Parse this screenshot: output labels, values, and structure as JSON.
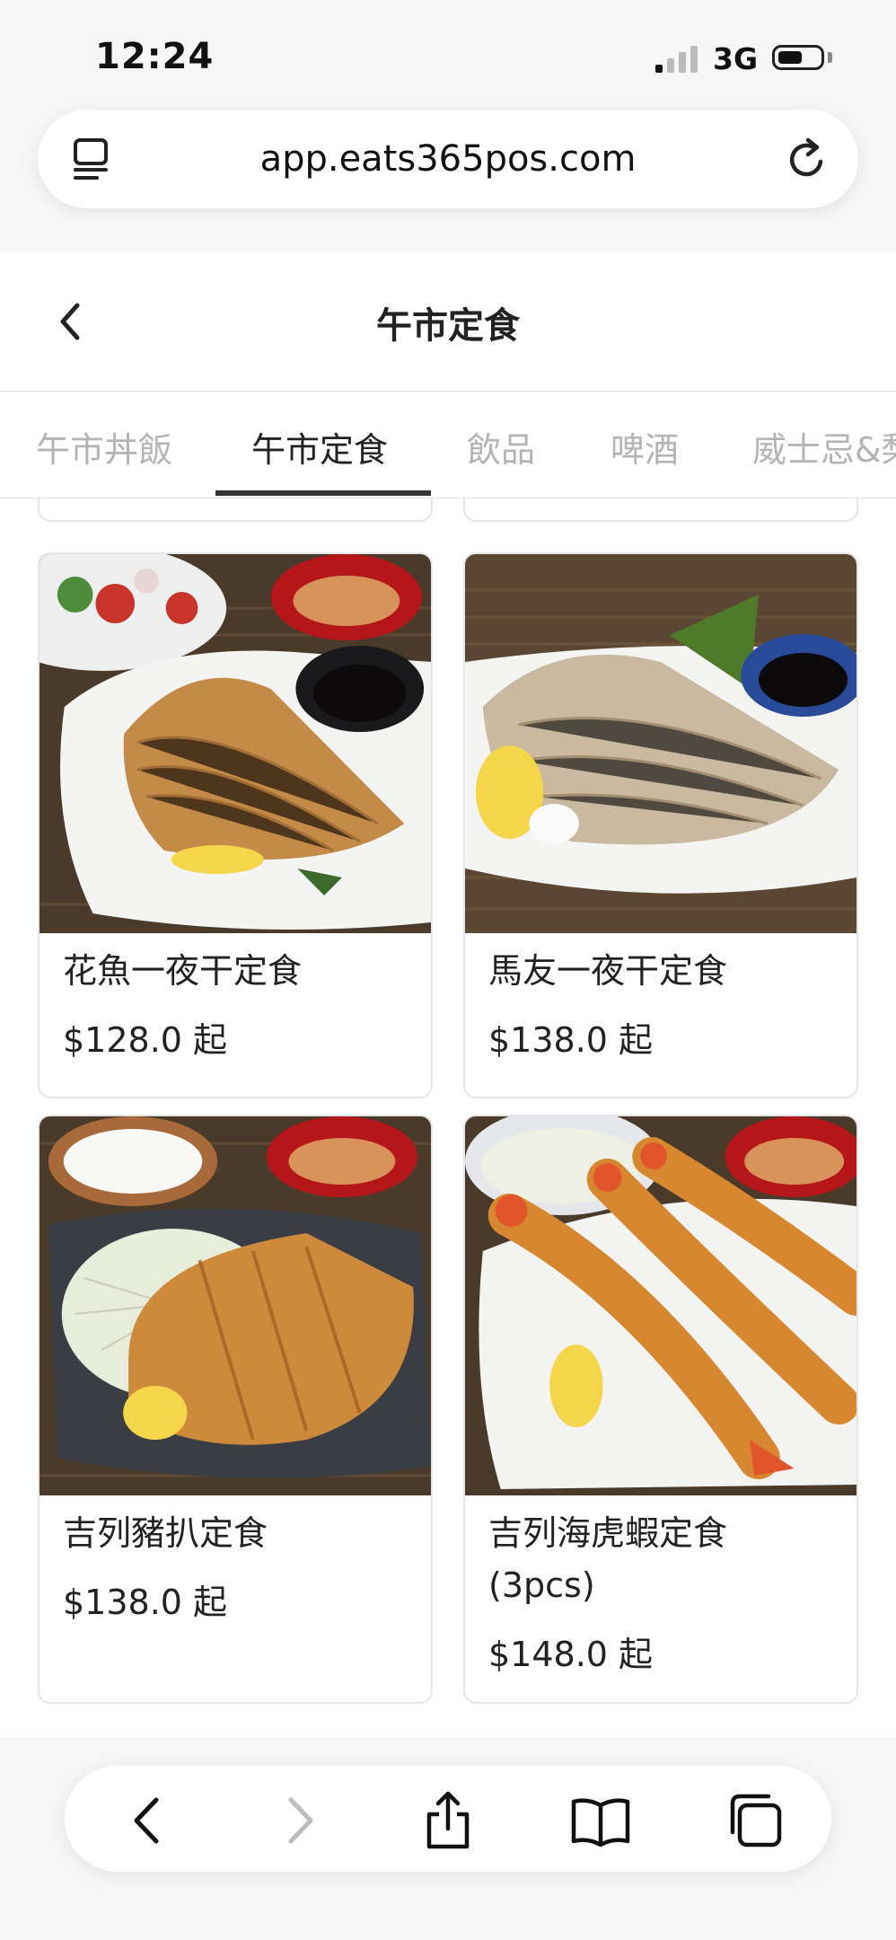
{
  "status_bar": {
    "time": "12:24",
    "network": "3G"
  },
  "browser": {
    "url": "app.eats365pos.com",
    "tabs_icon": "tabs-list-icon",
    "reload_icon": "reload-icon"
  },
  "header": {
    "title": "午市定食",
    "back_icon": "chevron-left-icon"
  },
  "categories": [
    {
      "label": "午市丼飯"
    },
    {
      "label": "午市定食",
      "active": true
    },
    {
      "label": "飲品"
    },
    {
      "label": "啤酒"
    },
    {
      "label": "威士忌&梨"
    }
  ],
  "items": [
    {
      "name": "花魚一夜干定食",
      "price": "$128.0 起"
    },
    {
      "name": "馬友一夜干定食",
      "price": "$138.0 起"
    },
    {
      "name": "吉列豬扒定食",
      "price": "$138.0 起"
    },
    {
      "name": "吉列海虎蝦定食",
      "name_line2": "(3pcs)",
      "price": "$148.0 起"
    }
  ],
  "toolbar": {
    "icons": [
      "back-arrow-icon",
      "forward-arrow-icon",
      "share-icon",
      "bookmarks-icon",
      "tabs-icon"
    ]
  },
  "colors": {
    "background": "#f6f6f7",
    "active_tab": "#222222",
    "inactive_tab": "#b4b4b4"
  }
}
